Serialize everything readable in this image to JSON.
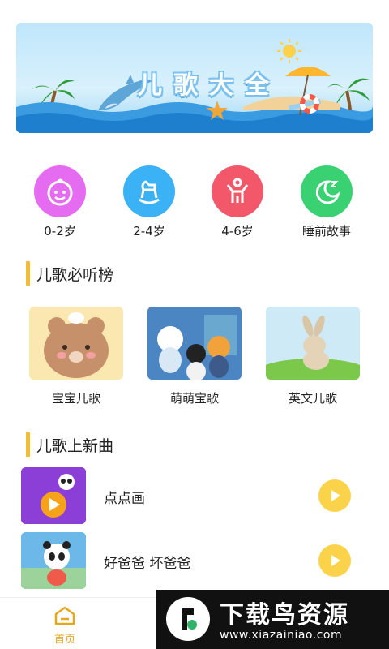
{
  "banner": {
    "title": "儿歌大全"
  },
  "categories": [
    {
      "label": "0-2岁",
      "color": "#e56cf0",
      "icon": "baby-face-icon"
    },
    {
      "label": "2-4岁",
      "color": "#3bb2f5",
      "icon": "rocking-horse-icon"
    },
    {
      "label": "4-6岁",
      "color": "#f2586a",
      "icon": "child-arms-up-icon"
    },
    {
      "label": "睡前故事",
      "color": "#3ad173",
      "icon": "moon-sleep-icon"
    }
  ],
  "section_must_listen": {
    "title": "儿歌必听榜"
  },
  "albums": [
    {
      "title": "宝宝儿歌",
      "thumb": "bear-thumbnail"
    },
    {
      "title": "萌萌宝歌",
      "thumb": "octonauts-thumbnail"
    },
    {
      "title": "英文儿歌",
      "thumb": "bunny-thumbnail"
    }
  ],
  "section_new_songs": {
    "title": "儿歌上新曲"
  },
  "new_songs": [
    {
      "title": "点点画"
    },
    {
      "title": "好爸爸 坏爸爸"
    }
  ],
  "tabbar": {
    "home_label": "首页"
  },
  "watermark": {
    "name": "下载鸟资源",
    "url": "www.xiazainiao.com"
  },
  "colors": {
    "accent_yellow": "#f4bd31",
    "play_yellow": "#fbd34a",
    "home_tab": "#e2a81e"
  }
}
